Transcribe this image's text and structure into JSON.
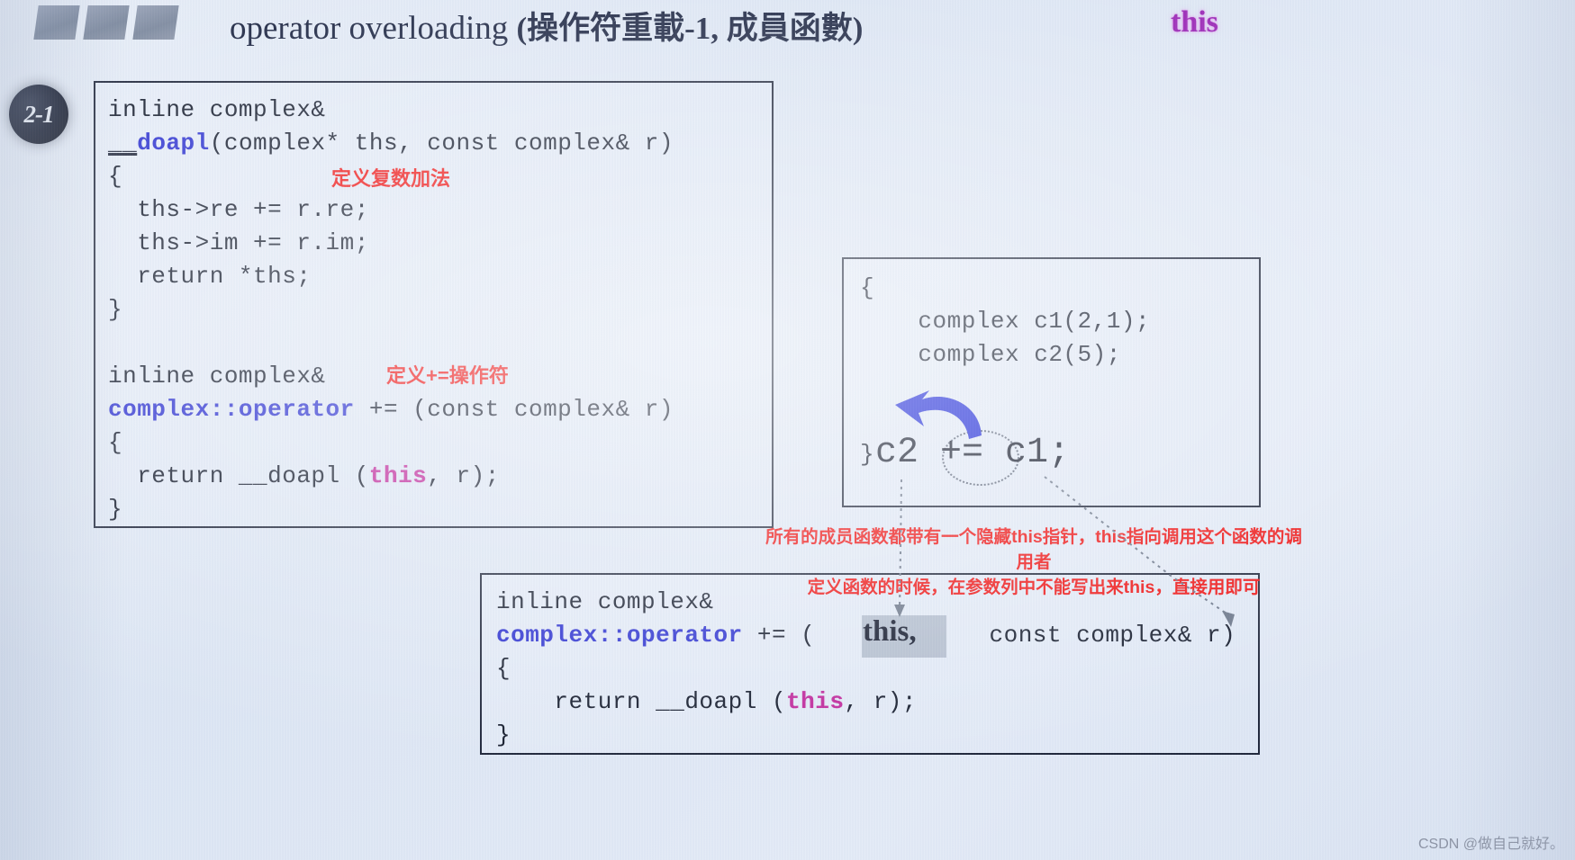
{
  "header": {
    "title_en": "operator overloading ",
    "title_cn": "(操作符重載-1, 成員函數)",
    "title_keyword": "this",
    "badge": "2-1",
    "accent_purple": "#9b26b6",
    "accent_blue": "#2a2fd0",
    "accent_red": "#f01010",
    "ink": "#131a2b"
  },
  "panels": {
    "main": {
      "name": "doapl-and-operator-definition",
      "lines": [
        "inline complex&",
        "__doapl(complex* ths, const complex& r)",
        "{",
        "    ths->re += r.re;",
        "    ths->im += r.im;",
        "    return *ths;",
        "}",
        "",
        "inline complex&",
        "complex::operator += (const complex& r)",
        "{",
        "    return __doapl (this, r);",
        "}"
      ],
      "token_doapl": "__doapl",
      "token_complex_operator": "complex::operator",
      "token_this": "this"
    },
    "usage": {
      "name": "usage-example",
      "lines": [
        "{",
        "    complex c1(2,1);",
        "    complex c2(5);",
        "",
        "",
        "}"
      ],
      "expression_left": "c2 ",
      "expression_op": "+=",
      "expression_right": " c1;"
    },
    "hidden": {
      "name": "hidden-this-explanation",
      "signature_line1": "inline complex&",
      "signature_blue": "complex::operator",
      "signature_rest": " += (",
      "signature_this": "this,",
      "signature_tail": " const complex& r)",
      "open_brace": "{",
      "return_line_pre": "    return __doapl (",
      "return_this": "this",
      "return_line_post": ", r);",
      "close_brace": "}"
    }
  },
  "annotations": {
    "define_complex_add": "定义复数加法",
    "define_pluseq_operator": "定义+=操作符",
    "hidden_this_note_line1": "所有的成员函数都带有一个隐藏this指针，this指向调用这个函数的调用者",
    "hidden_this_note_line2": "定义函数的时候，在参数列中不能写出来this，直接用即可"
  },
  "watermark": "CSDN @做自己就好。",
  "icons": {
    "curved_arrow": "curved-arrow-icon",
    "dotted_ellipse": "dotted-ellipse-highlight-icon",
    "deco_squares": "decorative-squares-icon"
  }
}
